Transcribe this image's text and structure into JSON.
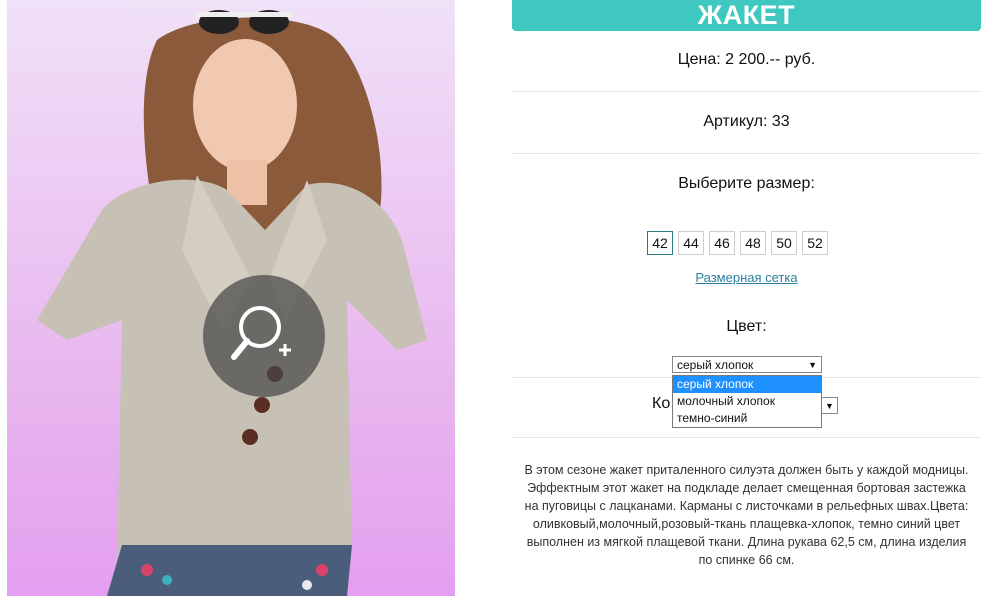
{
  "product": {
    "title": "ЖАКЕТ",
    "price": "Цена: 2 200.-- руб.",
    "sku": "Артикул: 33",
    "size_label": "Выберите размер:",
    "sizes": [
      "42",
      "44",
      "46",
      "48",
      "50",
      "52"
    ],
    "selected_size": "42",
    "size_chart_link": "Размерная сетка",
    "color_label": "Цвет:",
    "color_selected": "серый хлопок",
    "color_options": [
      "серый хлопок",
      "молочный хлопок",
      "темно-синий"
    ],
    "qty_label_partial": "Ко",
    "description": "В этом сезоне жакет приталенного силуэта должен быть у каждой модницы. Эффектным этот жакет на подкладе делает смещенная бортовая застежка на пуговицы с лацканами. Карманы с листочками в рельефных швах.Цвета: оливковый,молочный,розовый-ткань плащевка-хлопок, темно синий цвет выполнен из мягкой плащевой ткани. Длина рукава 62,5 см, длина изделия по спинке 66 см."
  },
  "colors": {
    "title_bar": "#3ec8c0",
    "link": "#2a7fa0",
    "dropdown_highlight": "#1e90ff"
  },
  "icons": {
    "zoom": "zoom-in-icon",
    "dropdown_arrow": "triangle-down"
  }
}
